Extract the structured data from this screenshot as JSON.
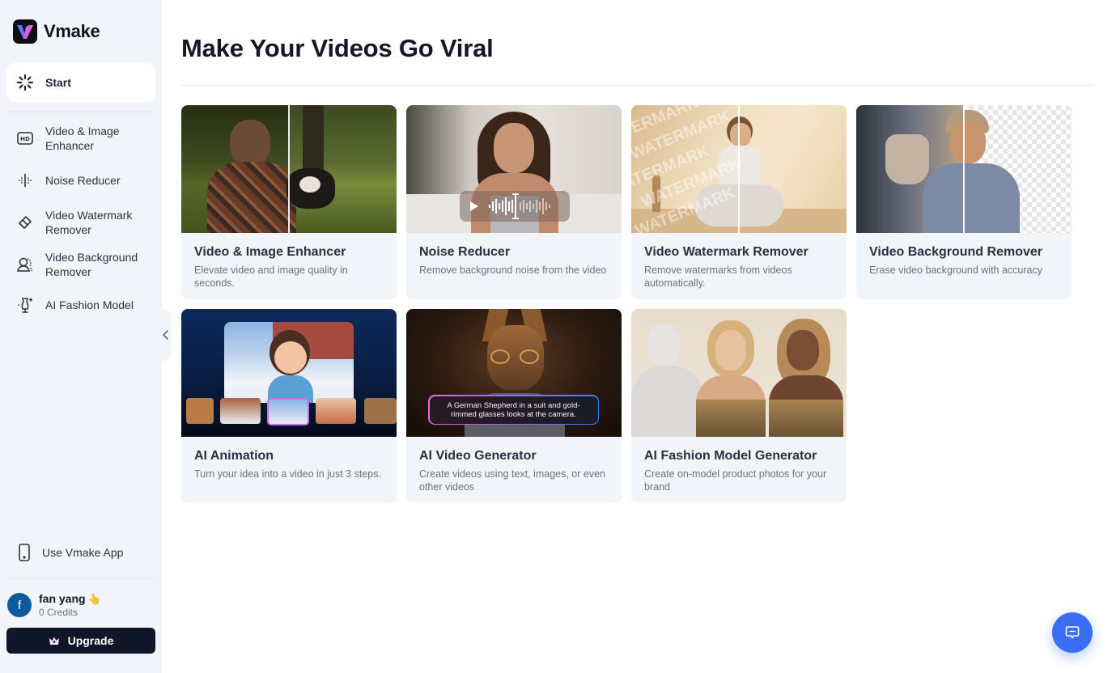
{
  "app": {
    "name": "Vmake"
  },
  "sidebar": {
    "start_label": "Start",
    "items": [
      {
        "label_line1": "Video & Image",
        "label_line2": "Enhancer",
        "icon": "hd-icon"
      },
      {
        "label_line1": "Noise Reducer",
        "label_line2": "",
        "icon": "waveform-icon"
      },
      {
        "label_line1": "Video Watermark",
        "label_line2": "Remover",
        "icon": "eraser-icon"
      },
      {
        "label_line1": "Video Background",
        "label_line2": "Remover",
        "icon": "person-cutout-icon"
      },
      {
        "label_line1": "AI Fashion Model",
        "label_line2": "",
        "icon": "mannequin-icon"
      }
    ],
    "use_app_label": "Use Vmake App",
    "user": {
      "avatar_letter": "f",
      "name": "fan yang",
      "badge_emoji": "👆",
      "credits": "0 Credits"
    },
    "upgrade_label": "Upgrade"
  },
  "main": {
    "title": "Make Your Videos Go Viral",
    "cards": [
      {
        "title": "Video & Image Enhancer",
        "desc": "Elevate video and image quality in seconds."
      },
      {
        "title": "Noise Reducer",
        "desc": "Remove background noise from the video"
      },
      {
        "title": "Video Watermark Remover",
        "desc": "Remove watermarks from videos automatically."
      },
      {
        "title": "Video Background Remover",
        "desc": "Erase video background with accuracy"
      },
      {
        "title": "AI Animation",
        "desc": "Turn your idea into a video in just 3 steps."
      },
      {
        "title": "AI Video Generator",
        "desc": "Create videos using text, images, or even other videos"
      },
      {
        "title": "AI Fashion Model Generator",
        "desc": "Create on-model product photos for your brand"
      }
    ],
    "watermark_text": "WATERMARK",
    "video_gen_prompt": "A German Shepherd in a suit and gold-rimmed glasses looks at the camera."
  },
  "colors": {
    "accent": "#3b6ef6",
    "upgrade_bg": "#0f1627",
    "sidebar_bg": "#f1f4f9",
    "card_bg": "#f1f4f9"
  }
}
